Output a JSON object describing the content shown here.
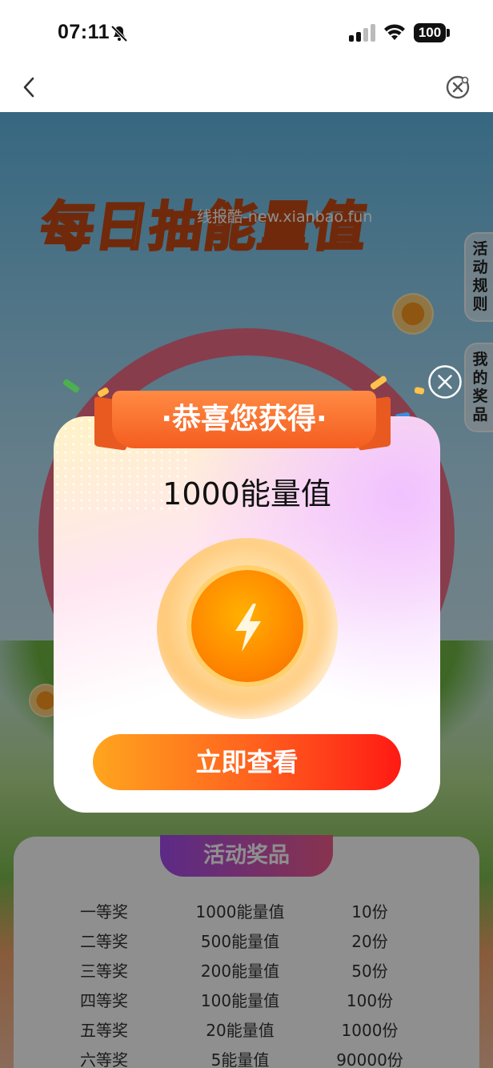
{
  "status_bar": {
    "time": "07:11",
    "battery": "100"
  },
  "nav": {
    "back_icon": "chevron-left-icon",
    "close_icon": "close-circle-icon"
  },
  "background": {
    "title": "每日抽能量值",
    "watermark": "线报酷-new.xianbao.fun",
    "side_tabs": [
      "活动规则",
      "我的奖品"
    ]
  },
  "modal": {
    "ribbon_text": "·恭喜您获得·",
    "prize": "1000能量值",
    "button_label": "立即查看",
    "close_icon": "close-circle-icon",
    "coin_icon": "lightning-bolt-icon"
  },
  "prizes": {
    "title": "活动奖品",
    "rows": [
      {
        "level": "一等奖",
        "reward": "1000能量值",
        "count": "10份"
      },
      {
        "level": "二等奖",
        "reward": "500能量值",
        "count": "20份"
      },
      {
        "level": "三等奖",
        "reward": "200能量值",
        "count": "50份"
      },
      {
        "level": "四等奖",
        "reward": "100能量值",
        "count": "100份"
      },
      {
        "level": "五等奖",
        "reward": "20能量值",
        "count": "1000份"
      },
      {
        "level": "六等奖",
        "reward": "5能量值",
        "count": "90000份"
      }
    ]
  },
  "colors": {
    "accent_orange": "#f45d20",
    "button_start": "#ffa51e",
    "button_end": "#ff1a14"
  }
}
